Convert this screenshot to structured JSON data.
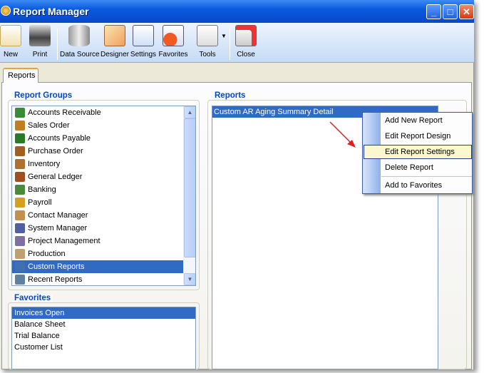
{
  "window": {
    "title": "Report Manager"
  },
  "toolbar": {
    "buttons": [
      {
        "label": "New",
        "icon": "new-report-icon"
      },
      {
        "label": "Print",
        "icon": "printer-icon"
      },
      {
        "label": "Data Source",
        "icon": "database-icon"
      },
      {
        "label": "Designer",
        "icon": "designer-icon"
      },
      {
        "label": "Settings",
        "icon": "settings-icon"
      },
      {
        "label": "Favorites",
        "icon": "favorites-icon"
      },
      {
        "label": "Tools",
        "icon": "tools-icon"
      },
      {
        "label": "Close",
        "icon": "close-report-icon"
      }
    ]
  },
  "tabs": {
    "reports": "Reports"
  },
  "report_groups": {
    "title": "Report Groups",
    "selected": "Custom Reports",
    "items": [
      "Accounts Receivable",
      "Sales Order",
      "Accounts Payable",
      "Purchase Order",
      "Inventory",
      "General Ledger",
      "Banking",
      "Payroll",
      "Contact Manager",
      "System Manager",
      "Project Management",
      "Production",
      "Custom Reports",
      "Recent Reports"
    ]
  },
  "favorites": {
    "title": "Favorites",
    "selected": "Invoices Open",
    "items": [
      "Invoices Open",
      "Balance Sheet",
      "Trial Balance",
      "Customer List"
    ]
  },
  "reports": {
    "title": "Reports",
    "items": [
      "Custom AR Aging Summary Detail"
    ]
  },
  "context_menu": {
    "highlighted": "Edit Report Settings",
    "items": [
      "Add New Report",
      "Edit Report Design",
      "Edit Report Settings",
      "Delete Report",
      "Add to Favorites"
    ]
  },
  "colors": {
    "selection": "#316ac5",
    "group_title": "#0046d5",
    "menu_highlight": "#fbf7cf",
    "arrow": "#e02020"
  }
}
